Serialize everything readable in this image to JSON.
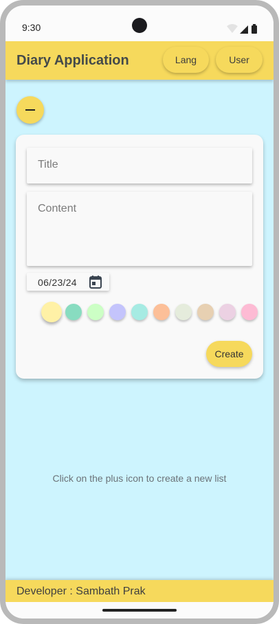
{
  "status_bar": {
    "time": "9:30",
    "icons": [
      "wifi-icon",
      "cell-signal-icon",
      "battery-icon"
    ]
  },
  "app_bar": {
    "title": "Diary Application",
    "lang_label": "Lang",
    "user_label": "User"
  },
  "fab": {
    "icon": "minus-icon"
  },
  "form": {
    "title_placeholder": "Title",
    "content_placeholder": "Content",
    "date": "06/23/24",
    "date_icon": "calendar-icon",
    "colors": [
      "#fff1a6",
      "#88dcc0",
      "#ccffc5",
      "#c4c4fc",
      "#a6ebe3",
      "#fcbf98",
      "#e5ecdc",
      "#e7d0b2",
      "#ecd1e3",
      "#fdbbd4"
    ],
    "selected_color_index": 0,
    "create_label": "Create"
  },
  "hint": "Click on the plus icon to create a new list",
  "footer": {
    "developer": "Developer : Sambath Prak"
  },
  "theme": {
    "accent": "#f6d95c",
    "background": "#cdf4fe"
  }
}
